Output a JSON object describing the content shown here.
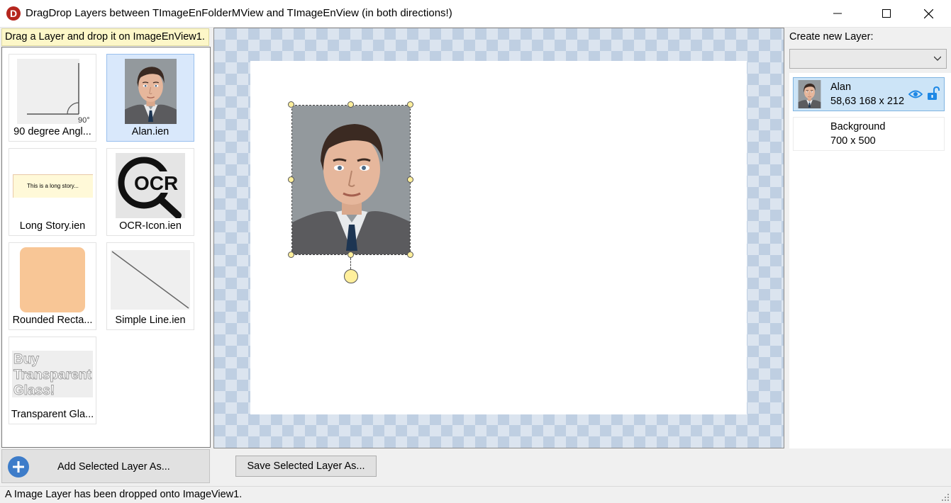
{
  "window": {
    "title": "DragDrop Layers between TImageEnFolderMView and TImageEnView (in both directions!)",
    "app_icon_glyph": "D"
  },
  "left_panel": {
    "hint": "Drag a Layer and drop it on ImageEnView1.",
    "thumbnails": [
      {
        "label": "90 degree Angl...",
        "icon": "angle-layer-thumbnail",
        "angle_text": "90°"
      },
      {
        "label": "Alan.ien",
        "icon": "portrait-thumbnail",
        "selected": true
      },
      {
        "label": "Long Story.ien",
        "icon": "text-layer-thumbnail",
        "text": "This is a long story..."
      },
      {
        "label": "OCR-Icon.ien",
        "icon": "ocr-icon-thumbnail",
        "text": "OCR"
      },
      {
        "label": "Rounded Recta...",
        "icon": "rounded-rect-thumbnail"
      },
      {
        "label": "Simple Line.ien",
        "icon": "line-thumbnail"
      },
      {
        "label": "Transparent Gla...",
        "icon": "transparent-text-thumbnail",
        "text_lines": [
          "Buy",
          "Transparent",
          "Glass!"
        ]
      }
    ],
    "add_button_label": "Add Selected Layer As..."
  },
  "center": {
    "save_button_label": "Save Selected Layer As..."
  },
  "right_panel": {
    "create_label": "Create new Layer:",
    "create_select_value": "",
    "layers": [
      {
        "name": "Alan",
        "info": "58,63  168 x 212",
        "selected": true
      },
      {
        "name": "Background",
        "info": "700 x 500",
        "selected": false
      }
    ]
  },
  "status": {
    "text": "A Image Layer has been dropped onto ImageView1."
  },
  "colors": {
    "accent": "#3d7cc9",
    "selection": "#cce4f7",
    "hint_bg": "#fdf7c8",
    "handle": "#ffef9c",
    "app_icon": "#b5261e"
  }
}
